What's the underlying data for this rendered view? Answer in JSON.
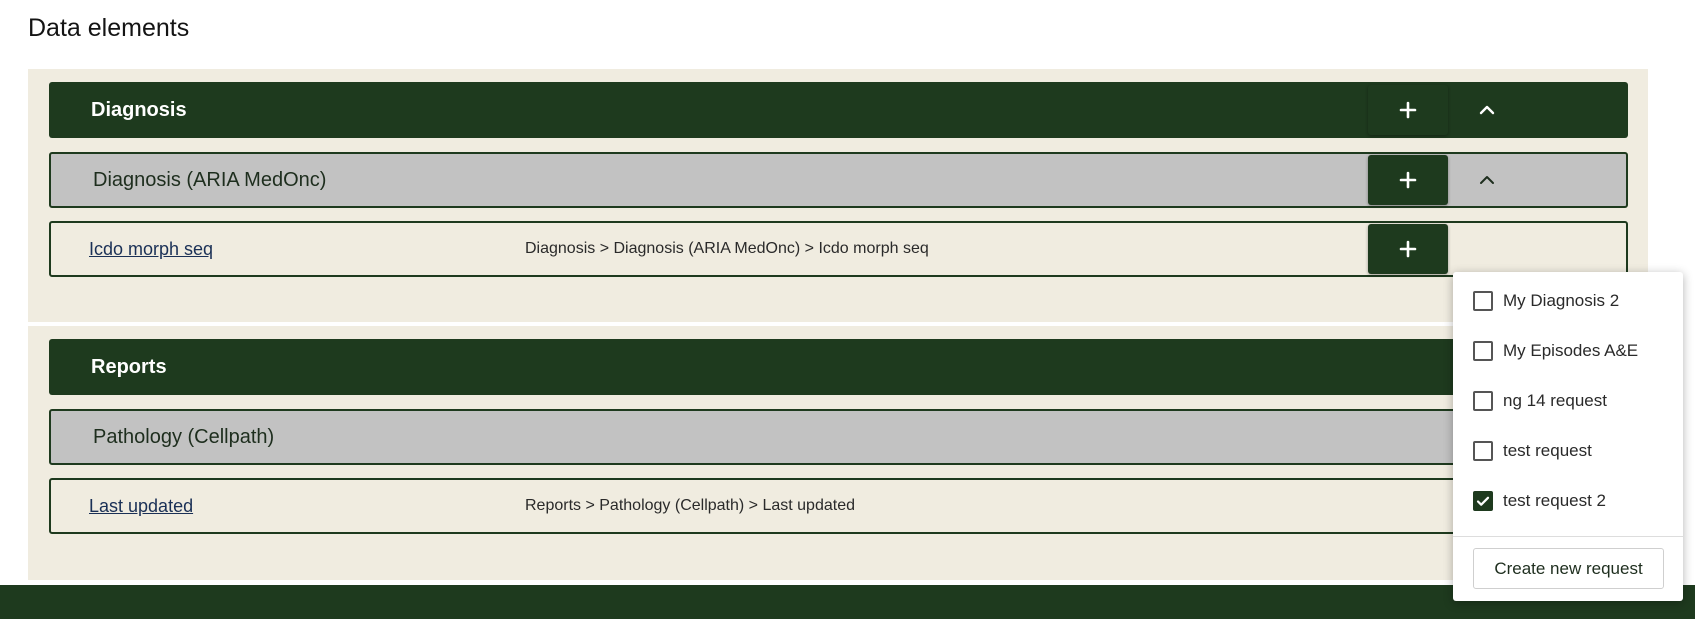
{
  "page": {
    "title": "Data elements"
  },
  "sections": [
    {
      "title": "Diagnosis",
      "subsection": "Diagnosis (ARIA MedOnc)",
      "row": {
        "name": "Icdo morph seq",
        "path": "Diagnosis > Diagnosis (ARIA MedOnc) > Icdo morph seq"
      }
    },
    {
      "title": "Reports",
      "subsection": "Pathology (Cellpath)",
      "row": {
        "name": "Last updated",
        "path": "Reports > Pathology (Cellpath) > Last updated"
      }
    }
  ],
  "icons": {
    "add": "plus-icon",
    "collapse": "chevron-up-icon",
    "check": "check-icon"
  },
  "dropdown": {
    "items": [
      {
        "label": "My Diagnosis 2",
        "checked": false
      },
      {
        "label": "My Episodes A&E",
        "checked": false
      },
      {
        "label": "ng 14 request",
        "checked": false
      },
      {
        "label": "test request",
        "checked": false
      },
      {
        "label": "test request 2",
        "checked": true
      }
    ],
    "create_label": "Create new request"
  },
  "colors": {
    "primary_green": "#1e3a1e",
    "panel_beige": "#f0ece0",
    "subheader_grey": "#c2c2c2",
    "link_blue": "#1a3056"
  }
}
